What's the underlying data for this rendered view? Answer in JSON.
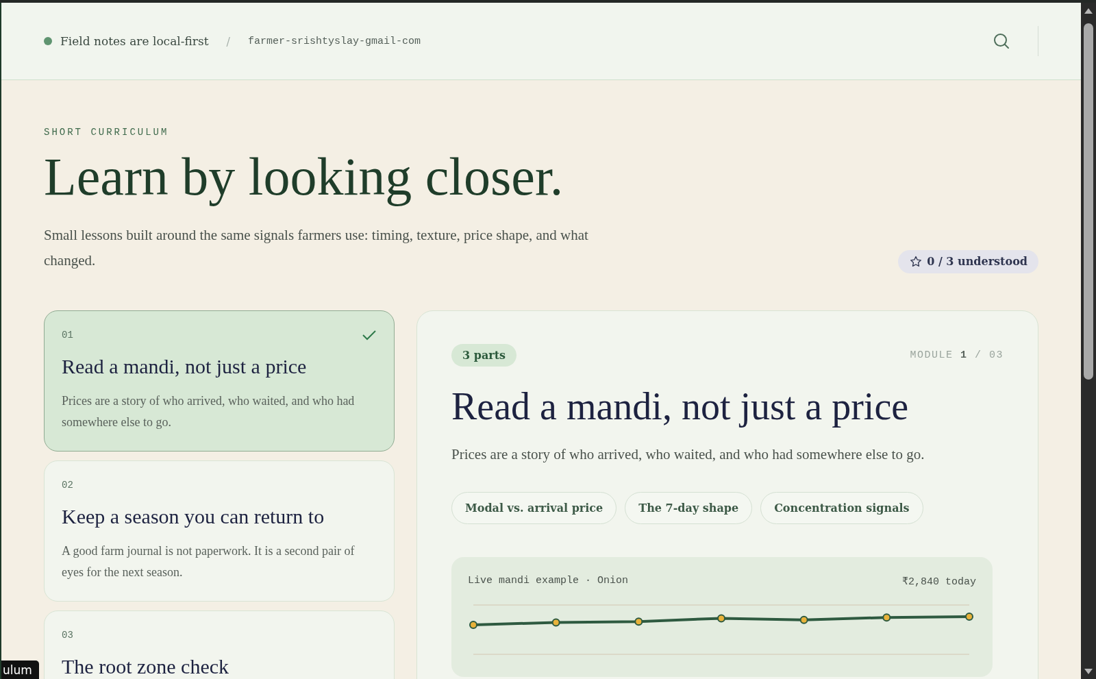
{
  "header": {
    "status": "Field notes are local-first",
    "separator": "/",
    "workspace": "farmer-srishtyslay-gmail-com"
  },
  "intro": {
    "eyebrow": "SHORT CURRICULUM",
    "title": "Learn by looking closer.",
    "lead": "Small lessons built around the same signals farmers use: timing, texture, price shape, and what changed.",
    "progress": "0 / 3 understood"
  },
  "modules": [
    {
      "number": "01",
      "title": "Read a mandi, not just a price",
      "summary": "Prices are a story of who arrived, who waited, and who had somewhere else to go.",
      "selected": true
    },
    {
      "number": "02",
      "title": "Keep a season you can return to",
      "summary": "A good farm journal is not paperwork. It is a second pair of eyes for the next season.",
      "selected": false
    },
    {
      "number": "03",
      "title": "The root zone check",
      "selected": false
    }
  ],
  "detail": {
    "parts_badge": "3 parts",
    "position": "MODULE **1** / 03",
    "title": "Read a mandi, not just a price",
    "summary": "Prices are a story of who arrived, who waited, and who had somewhere else to go.",
    "parts": [
      "Modal vs. arrival price",
      "The 7-day shape",
      "Concentration signals"
    ],
    "example": {
      "label": "Live mandi example · Onion",
      "price": "₹2,840 today"
    }
  },
  "tooltip": "ulum"
}
